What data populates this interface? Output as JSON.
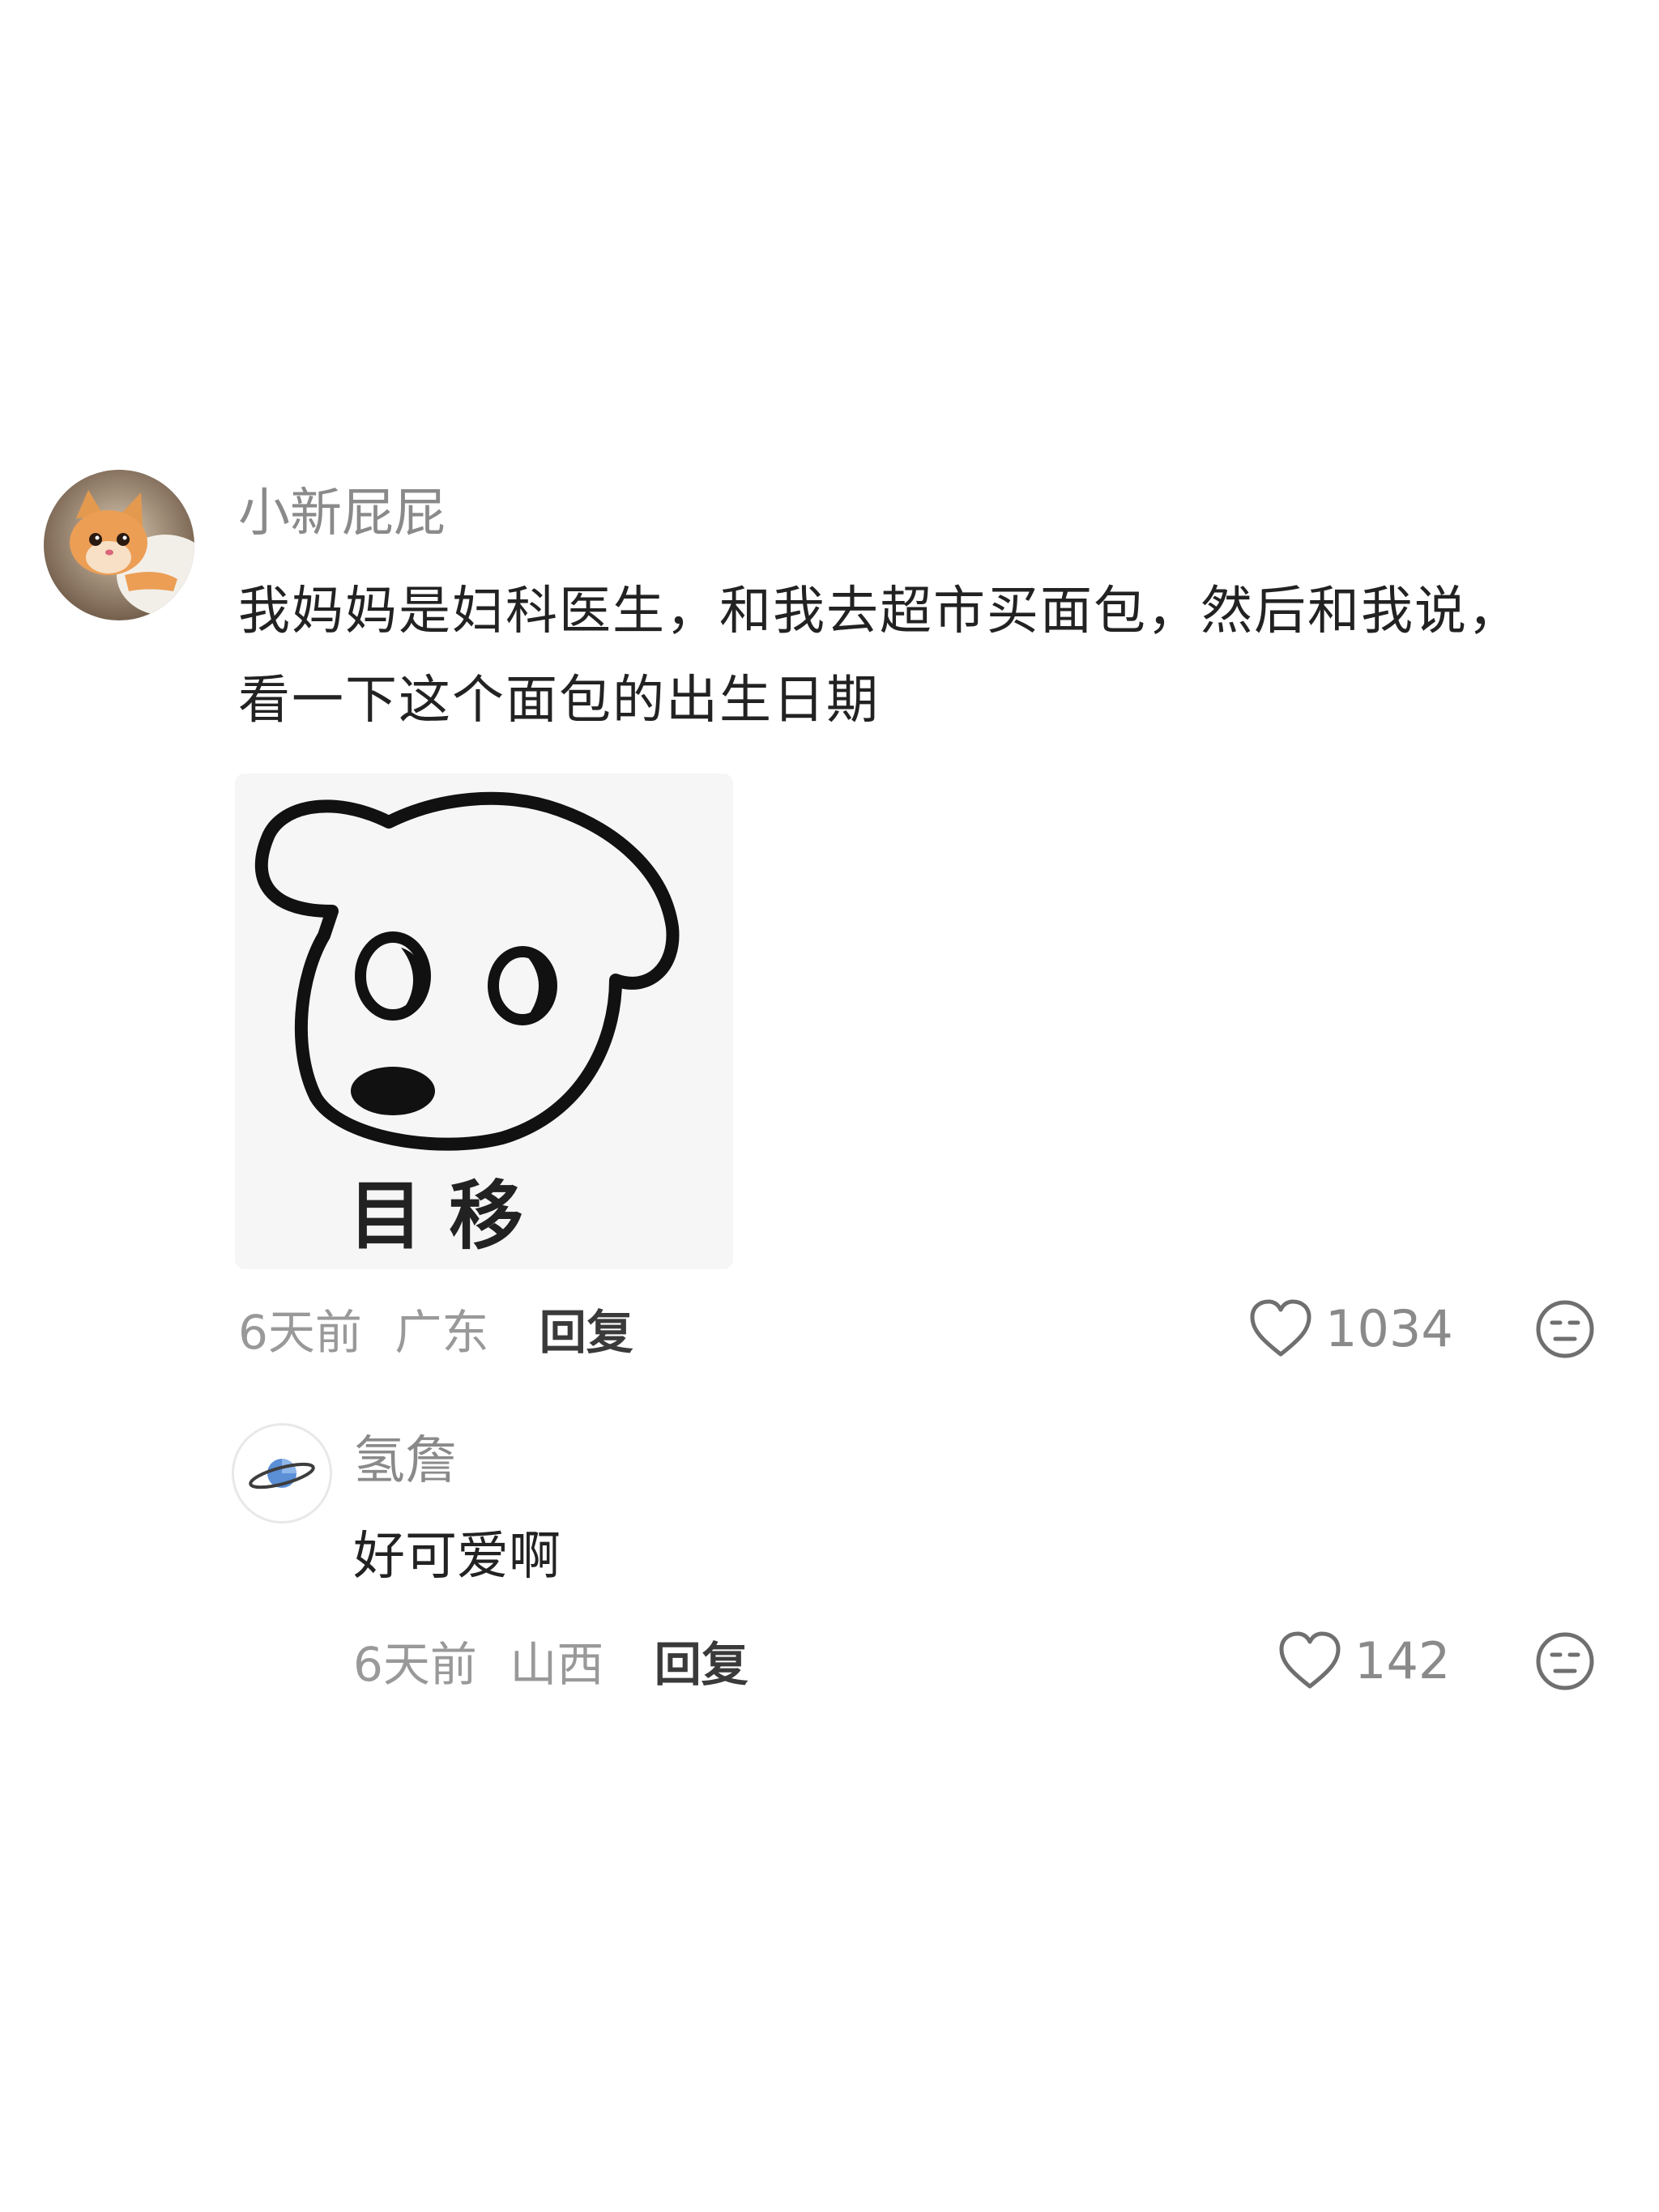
{
  "comments": [
    {
      "username": "小新屁屁",
      "avatar_icon": "cat-avatar-icon",
      "text_lines": [
        "我妈妈是妇科医生，和我去超市买面包，然后和我说，",
        "看一下这个面包的出生日期"
      ],
      "sticker": {
        "icon": "dog-meme-sticker",
        "caption": "目 移"
      },
      "time": "6天前",
      "location": "广东",
      "reply_label": "回复",
      "likes": "1034"
    },
    {
      "username": "氢詹",
      "avatar_icon": "planet-avatar-icon",
      "text": "好可爱啊",
      "time": "6天前",
      "location": "山西",
      "reply_label": "回复",
      "likes": "142"
    }
  ],
  "colors": {
    "username": "#8a8a8a",
    "text": "#222222",
    "meta": "#999999",
    "reply": "#3a3a3a",
    "planet": "#5b8fd6"
  }
}
